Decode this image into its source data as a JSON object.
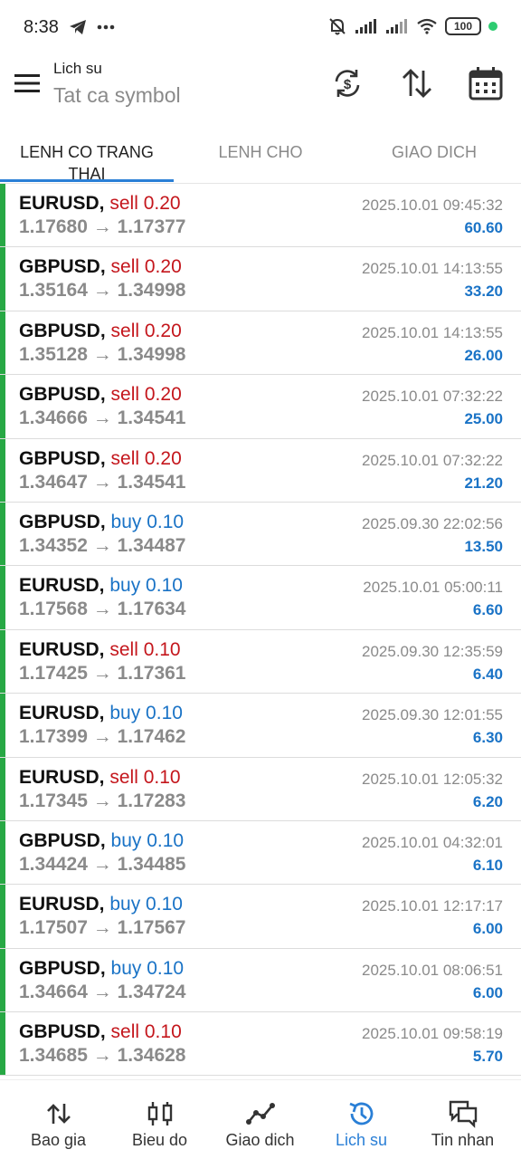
{
  "status": {
    "time": "8:38",
    "battery": "100"
  },
  "header": {
    "subtitle": "Lich su",
    "title": "Tat ca symbol"
  },
  "tabs": [
    {
      "line1": "LENH CO TRANG",
      "line2": "THAI"
    },
    {
      "line1": "LENH CHO",
      "line2": ""
    },
    {
      "line1": "GIAO DICH",
      "line2": ""
    }
  ],
  "rows": [
    {
      "symbol": "EURUSD,",
      "side": "sell 0.20",
      "prices": "1.17680 → 1.17377",
      "time": "2025.10.01 09:45:32",
      "profit": "60.60"
    },
    {
      "symbol": "GBPUSD,",
      "side": "sell 0.20",
      "prices": "1.35164 → 1.34998",
      "time": "2025.10.01 14:13:55",
      "profit": "33.20"
    },
    {
      "symbol": "GBPUSD,",
      "side": "sell 0.20",
      "prices": "1.35128 → 1.34998",
      "time": "2025.10.01 14:13:55",
      "profit": "26.00"
    },
    {
      "symbol": "GBPUSD,",
      "side": "sell 0.20",
      "prices": "1.34666 → 1.34541",
      "time": "2025.10.01 07:32:22",
      "profit": "25.00"
    },
    {
      "symbol": "GBPUSD,",
      "side": "sell 0.20",
      "prices": "1.34647 → 1.34541",
      "time": "2025.10.01 07:32:22",
      "profit": "21.20"
    },
    {
      "symbol": "GBPUSD,",
      "side": "buy 0.10",
      "prices": "1.34352 → 1.34487",
      "time": "2025.09.30 22:02:56",
      "profit": "13.50"
    },
    {
      "symbol": "EURUSD,",
      "side": "buy 0.10",
      "prices": "1.17568 → 1.17634",
      "time": "2025.10.01 05:00:11",
      "profit": "6.60"
    },
    {
      "symbol": "EURUSD,",
      "side": "sell 0.10",
      "prices": "1.17425 → 1.17361",
      "time": "2025.09.30 12:35:59",
      "profit": "6.40"
    },
    {
      "symbol": "EURUSD,",
      "side": "buy 0.10",
      "prices": "1.17399 → 1.17462",
      "time": "2025.09.30 12:01:55",
      "profit": "6.30"
    },
    {
      "symbol": "EURUSD,",
      "side": "sell 0.10",
      "prices": "1.17345 → 1.17283",
      "time": "2025.10.01 12:05:32",
      "profit": "6.20"
    },
    {
      "symbol": "GBPUSD,",
      "side": "buy 0.10",
      "prices": "1.34424 → 1.34485",
      "time": "2025.10.01 04:32:01",
      "profit": "6.10"
    },
    {
      "symbol": "EURUSD,",
      "side": "buy 0.10",
      "prices": "1.17507 → 1.17567",
      "time": "2025.10.01 12:17:17",
      "profit": "6.00"
    },
    {
      "symbol": "GBPUSD,",
      "side": "buy 0.10",
      "prices": "1.34664 → 1.34724",
      "time": "2025.10.01 08:06:51",
      "profit": "6.00"
    },
    {
      "symbol": "GBPUSD,",
      "side": "sell 0.10",
      "prices": "1.34685 → 1.34628",
      "time": "2025.10.01 09:58:19",
      "profit": "5.70"
    }
  ],
  "nav": [
    {
      "label": "Bao gia",
      "icon": "quotes-icon"
    },
    {
      "label": "Bieu do",
      "icon": "chart-icon"
    },
    {
      "label": "Giao dich",
      "icon": "trade-icon"
    },
    {
      "label": "Lich su",
      "icon": "history-icon"
    },
    {
      "label": "Tin nhan",
      "icon": "messages-icon"
    }
  ],
  "colors": {
    "sell": "#c4161c",
    "buy": "#1a73c6",
    "accent": "#2a7fd6",
    "row_bar": "#27a844"
  }
}
